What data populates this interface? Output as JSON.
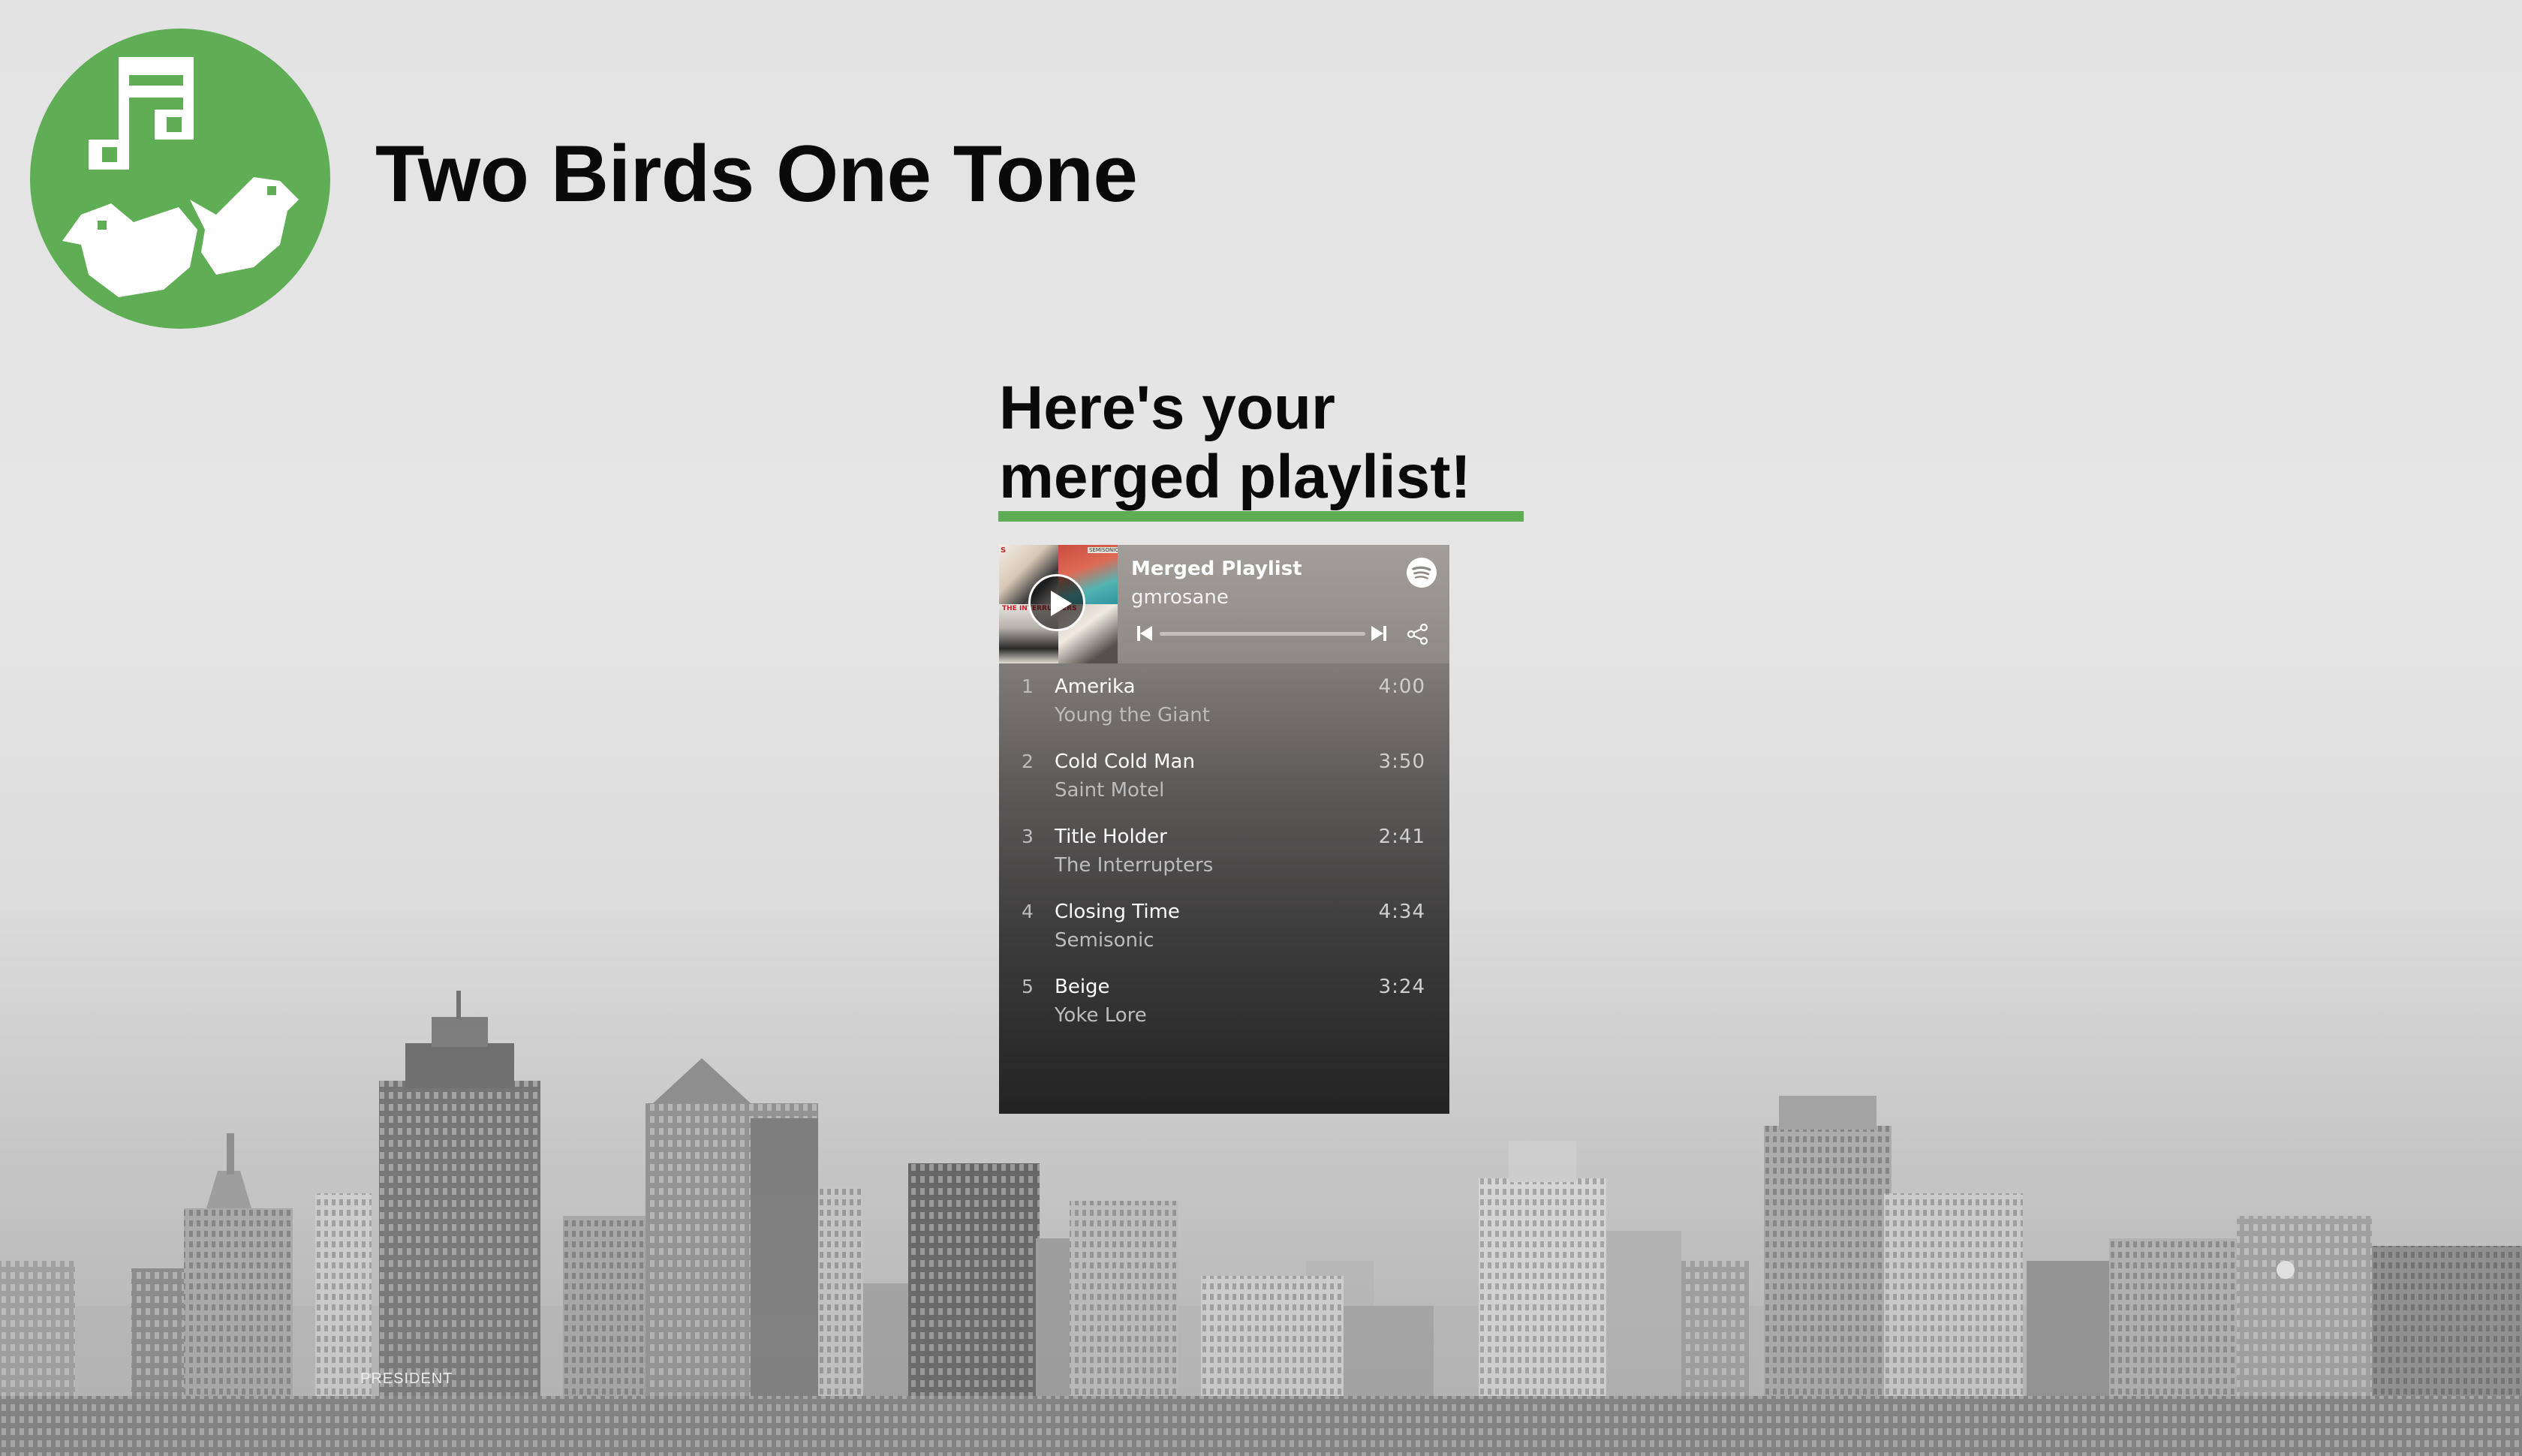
{
  "site": {
    "title": "Two Birds One Tone"
  },
  "result": {
    "heading_line1": "Here's your",
    "heading_line2": "merged playlist!"
  },
  "embed": {
    "playlist_title": "Merged Playlist",
    "owner": "gmrosane",
    "cover_texts": [
      "S",
      "SEMISONIC",
      "THE INTERRUPTERS"
    ],
    "tracks": [
      {
        "number": "1",
        "name": "Amerika",
        "artist": "Young the Giant",
        "duration": "4:00"
      },
      {
        "number": "2",
        "name": "Cold Cold Man",
        "artist": "Saint Motel",
        "duration": "3:50"
      },
      {
        "number": "3",
        "name": "Title Holder",
        "artist": "The Interrupters",
        "duration": "2:41"
      },
      {
        "number": "4",
        "name": "Closing Time",
        "artist": "Semisonic",
        "duration": "4:34"
      },
      {
        "number": "5",
        "name": "Beige",
        "artist": "Yoke Lore",
        "duration": "3:24"
      }
    ]
  },
  "background": {
    "sign_text": "PRESIDENT"
  },
  "colors": {
    "accent": "#5fae55",
    "text": "#0a0a0a",
    "background": "#e5e5e5"
  },
  "icons": [
    "logo-birds-music-icon",
    "play-icon",
    "spotify-icon",
    "skip-back-icon",
    "skip-forward-icon",
    "share-icon"
  ]
}
